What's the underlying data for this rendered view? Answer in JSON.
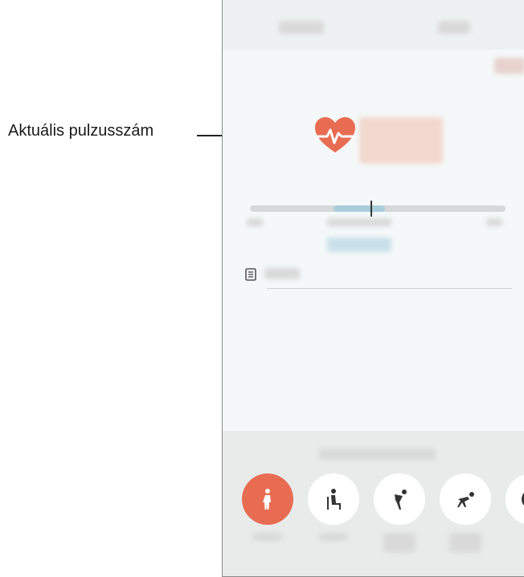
{
  "callout": {
    "label": "Aktuális pulzusszám"
  },
  "colors": {
    "accent": "#e86c52",
    "range": "#a9ccdb",
    "background": "#f4f8f8"
  },
  "icons": {
    "heart": "heart-rate-icon",
    "note": "note-icon",
    "activities": [
      "walking-icon",
      "sitting-icon",
      "exercise-icon",
      "running-icon",
      "other-icon"
    ]
  },
  "activities": {
    "selected_index": 0
  }
}
